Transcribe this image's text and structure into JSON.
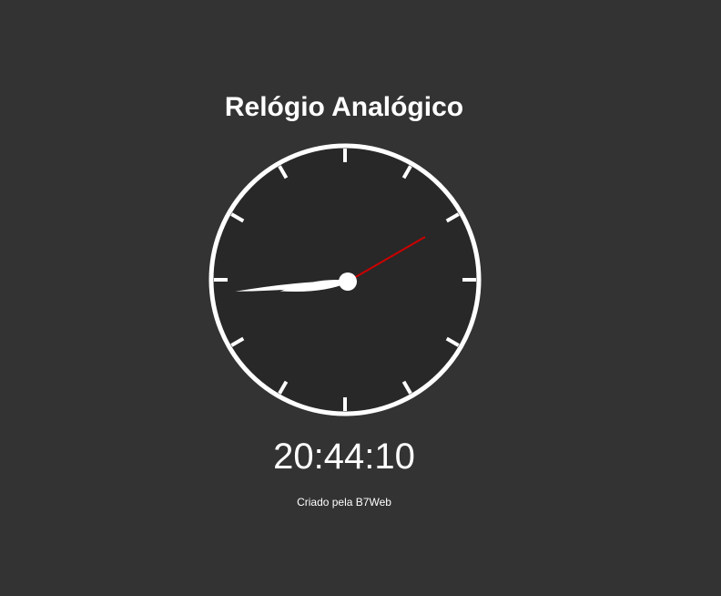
{
  "page": {
    "title": "Relógio Analógico",
    "credit": "Criado pela B7Web"
  },
  "clock": {
    "digital_time": "20:44:10",
    "hours": 20,
    "minutes": 44,
    "seconds": 10,
    "tick_count": 12
  },
  "colors": {
    "background": "#333333",
    "clock_face": "#282828",
    "border": "#ffffff",
    "hands": "#ffffff",
    "second_hand": "#cc0000"
  },
  "icons": {
    "clock": "analog-clock-icon"
  }
}
